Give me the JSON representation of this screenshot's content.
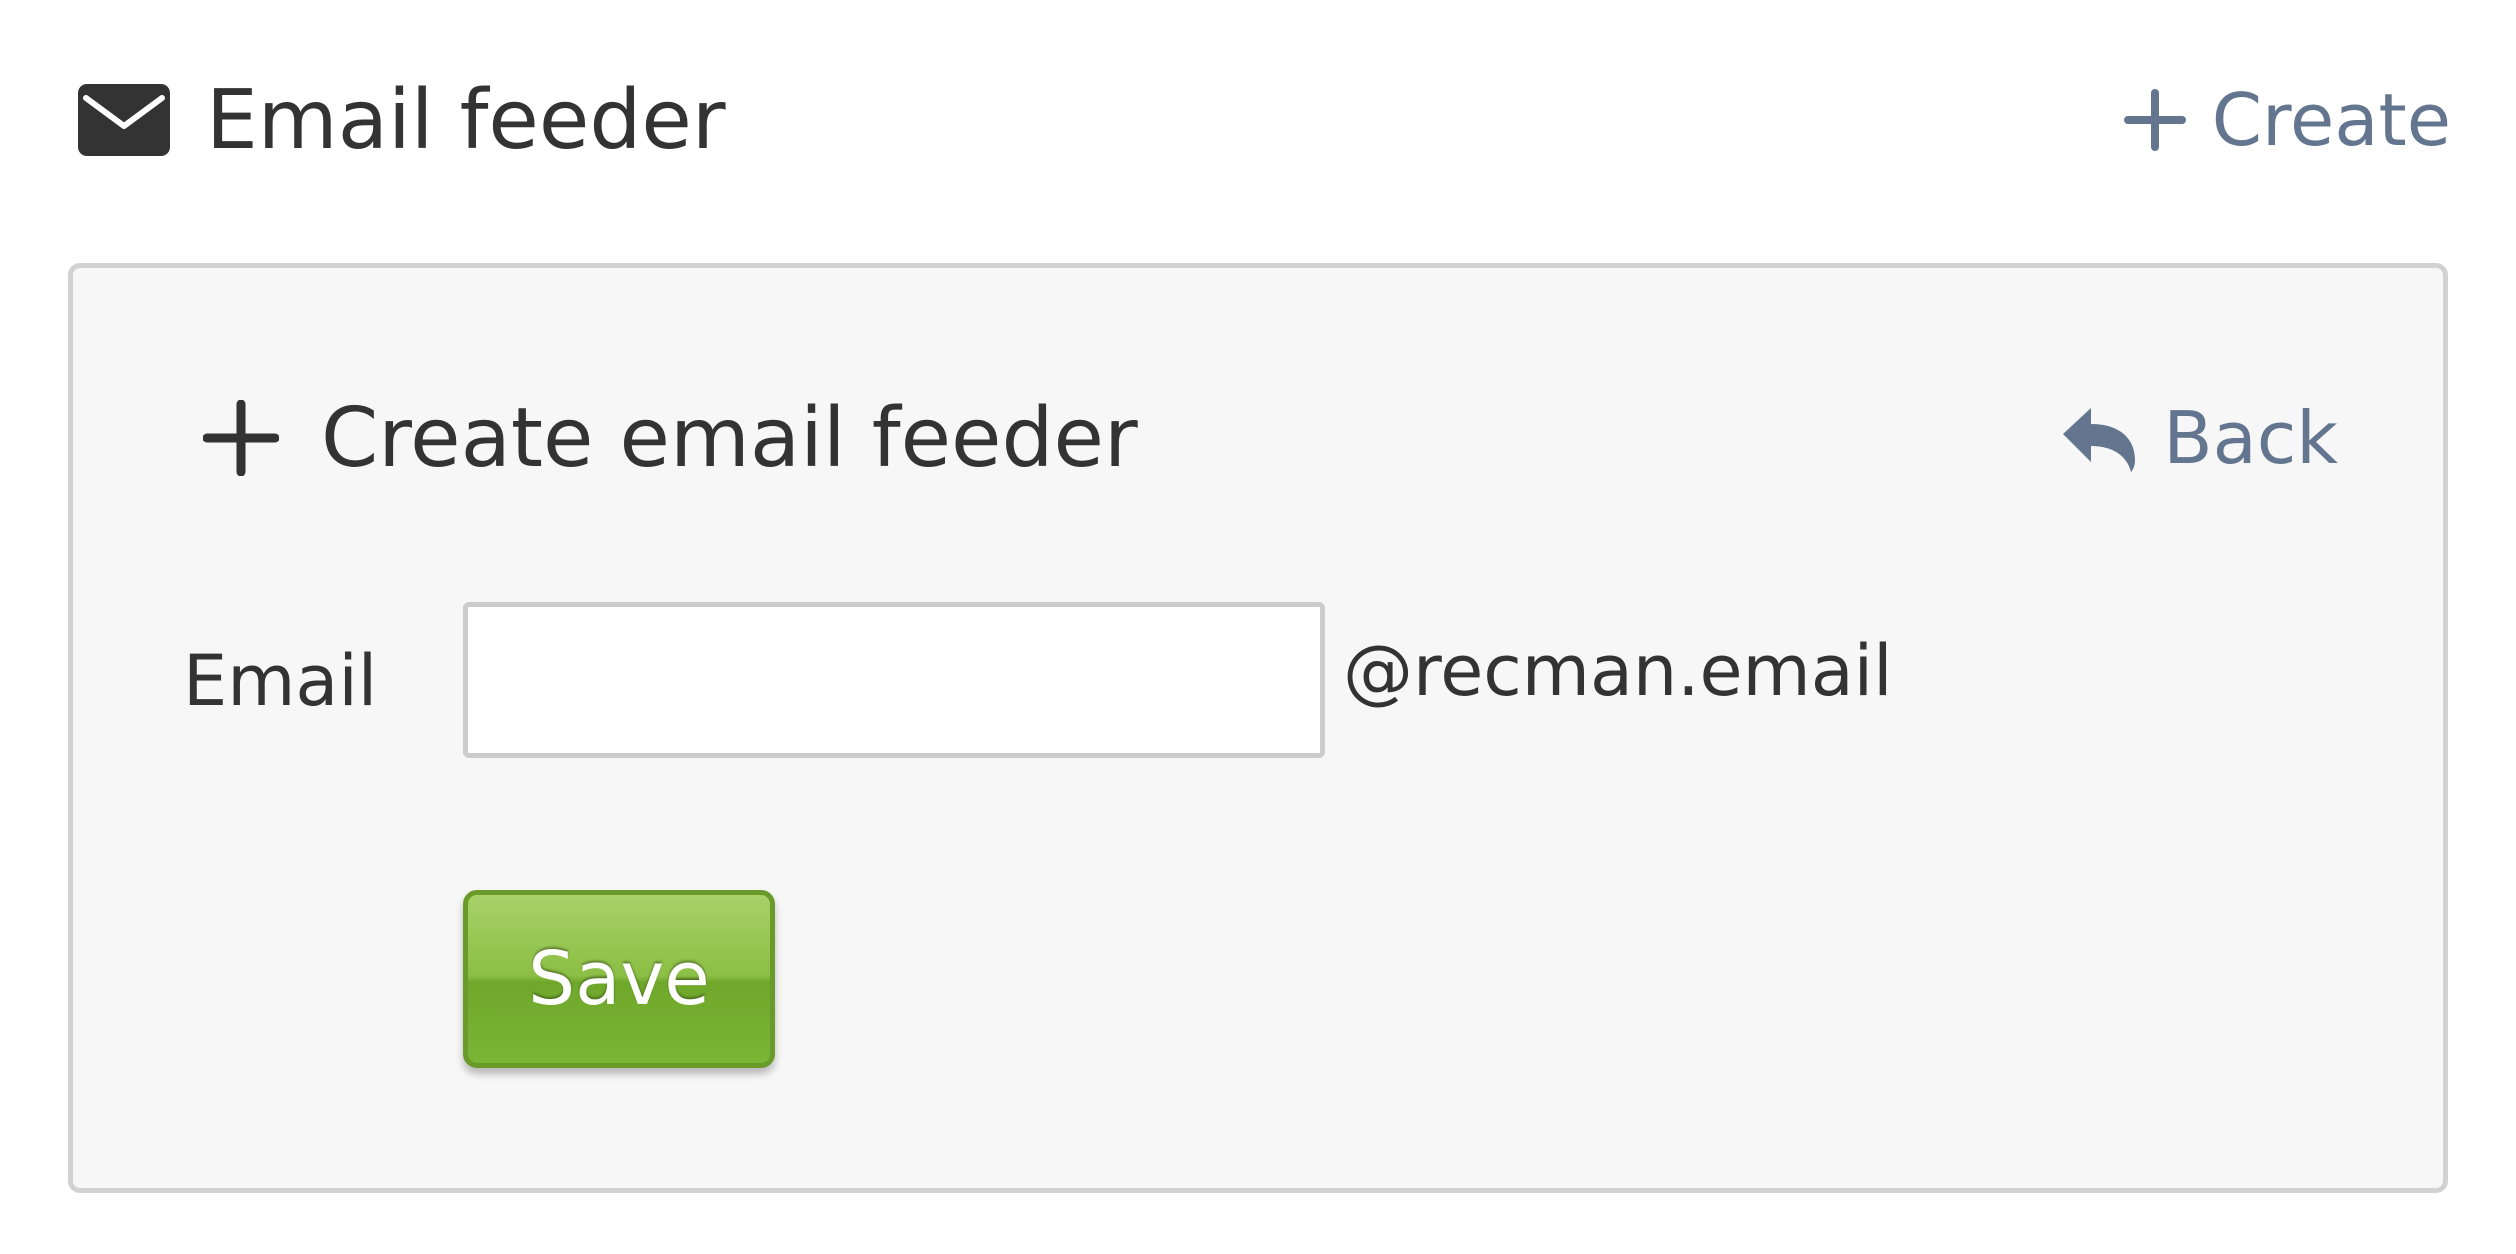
{
  "header": {
    "title": "Email feeder",
    "title_icon": "envelope-icon",
    "create_label": "Create",
    "create_icon": "plus-icon"
  },
  "panel": {
    "title": "Create email feeder",
    "title_icon": "plus-icon",
    "back_label": "Back",
    "back_icon": "reply-arrow-icon"
  },
  "form": {
    "email_label": "Email",
    "email_value": "",
    "email_placeholder": "",
    "email_suffix": "@recman.email",
    "save_label": "Save"
  },
  "colors": {
    "link": "#64768f",
    "text": "#333333",
    "panel_bg": "#f7f7f7",
    "panel_border": "#d2d2d2",
    "save_green": "#7ab635"
  }
}
